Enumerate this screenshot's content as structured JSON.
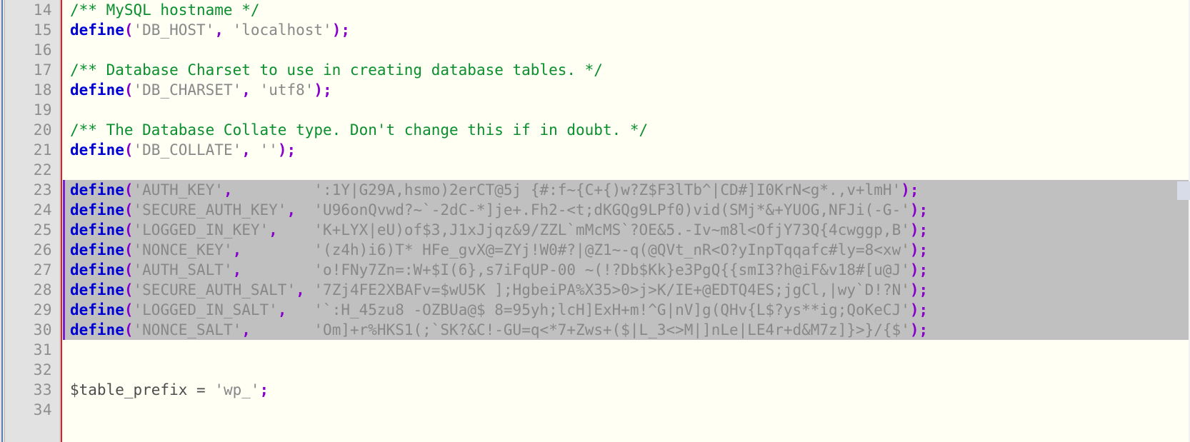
{
  "editor": {
    "title": "wp-config.php",
    "language": "PHP",
    "colors": {
      "keyword": "#0000d4",
      "string": "#888888",
      "comment": "#0a8f2e",
      "punctuation": "#8800cc",
      "selection": "#c0c0c0",
      "gutter_bg": "#e2e2e2",
      "code_bg": "#fffff4",
      "change_bar": "#e02020",
      "caret": "#7a1fd0"
    },
    "first_visible_line": 14,
    "last_visible_line": 34,
    "selected_lines": [
      23,
      24,
      25,
      26,
      27,
      28,
      29,
      30
    ]
  },
  "lines": [
    {
      "number": "14",
      "selected": false,
      "tokens": [
        {
          "text": "/** MySQL hostname */",
          "type": "comment"
        }
      ]
    },
    {
      "number": "15",
      "selected": false,
      "tokens": [
        {
          "text": "define",
          "type": "keyword"
        },
        {
          "text": "(",
          "type": "punctuation"
        },
        {
          "text": "'DB_HOST'",
          "type": "string"
        },
        {
          "text": ",",
          "type": "punctuation"
        },
        {
          "text": " ",
          "type": "plain"
        },
        {
          "text": "'localhost'",
          "type": "string"
        },
        {
          "text": ");",
          "type": "punctuation"
        }
      ]
    },
    {
      "number": "16",
      "selected": false,
      "tokens": []
    },
    {
      "number": "17",
      "selected": false,
      "tokens": [
        {
          "text": "/** Database Charset to use in creating database tables. */",
          "type": "comment"
        }
      ]
    },
    {
      "number": "18",
      "selected": false,
      "tokens": [
        {
          "text": "define",
          "type": "keyword"
        },
        {
          "text": "(",
          "type": "punctuation"
        },
        {
          "text": "'DB_CHARSET'",
          "type": "string"
        },
        {
          "text": ",",
          "type": "punctuation"
        },
        {
          "text": " ",
          "type": "plain"
        },
        {
          "text": "'utf8'",
          "type": "string"
        },
        {
          "text": ");",
          "type": "punctuation"
        }
      ]
    },
    {
      "number": "19",
      "selected": false,
      "tokens": []
    },
    {
      "number": "20",
      "selected": false,
      "tokens": [
        {
          "text": "/** The Database Collate type. Don't change this if in doubt. */",
          "type": "comment"
        }
      ]
    },
    {
      "number": "21",
      "selected": false,
      "tokens": [
        {
          "text": "define",
          "type": "keyword"
        },
        {
          "text": "(",
          "type": "punctuation"
        },
        {
          "text": "'DB_COLLATE'",
          "type": "string"
        },
        {
          "text": ",",
          "type": "punctuation"
        },
        {
          "text": " ",
          "type": "plain"
        },
        {
          "text": "''",
          "type": "string"
        },
        {
          "text": ");",
          "type": "punctuation"
        }
      ]
    },
    {
      "number": "22",
      "selected": false,
      "tokens": []
    },
    {
      "number": "23",
      "selected": true,
      "tokens": [
        {
          "text": "define",
          "type": "keyword"
        },
        {
          "text": "(",
          "type": "punctuation"
        },
        {
          "text": "'AUTH_KEY'",
          "type": "string"
        },
        {
          "text": ",",
          "type": "punctuation"
        },
        {
          "text": "         ",
          "type": "plain"
        },
        {
          "text": "':1Y|G29A,hsmo)2erCT@5j {#:f~{C+{)w?Z$F3lTb^|CD#]I0KrN<g*.,v+lmH'",
          "type": "string"
        },
        {
          "text": ");",
          "type": "punctuation"
        }
      ]
    },
    {
      "number": "24",
      "selected": true,
      "tokens": [
        {
          "text": "define",
          "type": "keyword"
        },
        {
          "text": "(",
          "type": "punctuation"
        },
        {
          "text": "'SECURE_AUTH_KEY'",
          "type": "string"
        },
        {
          "text": ",",
          "type": "punctuation"
        },
        {
          "text": "  ",
          "type": "plain"
        },
        {
          "text": "'U96onQvwd?~`-2dC-*]je+.Fh2-<t;dKGQg9LPf0)vid(SMj*&+YUOG,NFJi(-G-'",
          "type": "string"
        },
        {
          "text": ");",
          "type": "punctuation"
        }
      ]
    },
    {
      "number": "25",
      "selected": true,
      "tokens": [
        {
          "text": "define",
          "type": "keyword"
        },
        {
          "text": "(",
          "type": "punctuation"
        },
        {
          "text": "'LOGGED_IN_KEY'",
          "type": "string"
        },
        {
          "text": ",",
          "type": "punctuation"
        },
        {
          "text": "    ",
          "type": "plain"
        },
        {
          "text": "'K+LYX|eU)of$3,J1xJjqz&9/ZZL`mMcMS`?OE&5.-Iv~m8l<OfjY73Q{4cwggp,B'",
          "type": "string"
        },
        {
          "text": ");",
          "type": "punctuation"
        }
      ]
    },
    {
      "number": "26",
      "selected": true,
      "tokens": [
        {
          "text": "define",
          "type": "keyword"
        },
        {
          "text": "(",
          "type": "punctuation"
        },
        {
          "text": "'NONCE_KEY'",
          "type": "string"
        },
        {
          "text": ",",
          "type": "punctuation"
        },
        {
          "text": "        ",
          "type": "plain"
        },
        {
          "text": "'(z4h)i6)T* HFe_gvX@=ZYj!W0#?|@Z1~-q(@QVt_nR<O?yInpTqqafc#ly=8<xw'",
          "type": "string"
        },
        {
          "text": ");",
          "type": "punctuation"
        }
      ]
    },
    {
      "number": "27",
      "selected": true,
      "tokens": [
        {
          "text": "define",
          "type": "keyword"
        },
        {
          "text": "(",
          "type": "punctuation"
        },
        {
          "text": "'AUTH_SALT'",
          "type": "string"
        },
        {
          "text": ",",
          "type": "punctuation"
        },
        {
          "text": "        ",
          "type": "plain"
        },
        {
          "text": "'o!FNy7Zn=:W+$I(6},s7iFqUP-00 ~(!?Db$Kk}e3PgQ{{smI3?h@iF&v18#[u@J'",
          "type": "string"
        },
        {
          "text": ");",
          "type": "punctuation"
        }
      ]
    },
    {
      "number": "28",
      "selected": true,
      "tokens": [
        {
          "text": "define",
          "type": "keyword"
        },
        {
          "text": "(",
          "type": "punctuation"
        },
        {
          "text": "'SECURE_AUTH_SALT'",
          "type": "string"
        },
        {
          "text": ",",
          "type": "punctuation"
        },
        {
          "text": " ",
          "type": "plain"
        },
        {
          "text": "'7Zj4FE2XBAFv=$wU5K ];HgbeiPA%X35>0>j>K/IE+@EDTQ4ES;jgCl,|wy`D!?N'",
          "type": "string"
        },
        {
          "text": ");",
          "type": "punctuation"
        }
      ]
    },
    {
      "number": "29",
      "selected": true,
      "tokens": [
        {
          "text": "define",
          "type": "keyword"
        },
        {
          "text": "(",
          "type": "punctuation"
        },
        {
          "text": "'LOGGED_IN_SALT'",
          "type": "string"
        },
        {
          "text": ",",
          "type": "punctuation"
        },
        {
          "text": "   ",
          "type": "plain"
        },
        {
          "text": "'`:H_45zu8 -OZBUa@$ 8=95yh;lcH]ExH+m!^G|nV]g(QHv{L$?ys**ig;QoKeCJ'",
          "type": "string"
        },
        {
          "text": ");",
          "type": "punctuation"
        }
      ]
    },
    {
      "number": "30",
      "selected": true,
      "tokens": [
        {
          "text": "define",
          "type": "keyword"
        },
        {
          "text": "(",
          "type": "punctuation"
        },
        {
          "text": "'NONCE_SALT'",
          "type": "string"
        },
        {
          "text": ",",
          "type": "punctuation"
        },
        {
          "text": "       ",
          "type": "plain"
        },
        {
          "text": "'Om]+r%HKS1(;`SK?&C!-GU=q<*7+Zws+($|L_3<>M|]nLe|LE4r+d&M7z]}>}/{$'",
          "type": "string"
        },
        {
          "text": ");",
          "type": "punctuation"
        }
      ]
    },
    {
      "number": "31",
      "selected": false,
      "tokens": []
    },
    {
      "number": "32",
      "selected": false,
      "tokens": []
    },
    {
      "number": "33",
      "selected": false,
      "tokens": [
        {
          "text": "$table_prefix",
          "type": "variable"
        },
        {
          "text": " = ",
          "type": "plain"
        },
        {
          "text": "'wp_'",
          "type": "string"
        },
        {
          "text": ";",
          "type": "punctuation"
        }
      ]
    },
    {
      "number": "34",
      "selected": false,
      "tokens": []
    }
  ]
}
